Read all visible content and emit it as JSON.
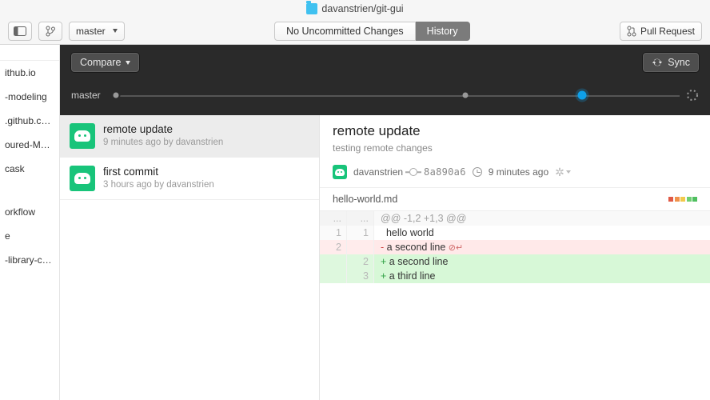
{
  "titlebar": {
    "repo_path": "davanstrien/git-gui"
  },
  "toolbar": {
    "branch_label": "master",
    "tab_changes": "No Uncommitted Changes",
    "tab_history": "History",
    "pull_request": "Pull Request",
    "active_tab": "history"
  },
  "compare_bar": {
    "compare_label": "Compare",
    "sync_label": "Sync",
    "branch_label": "master"
  },
  "repostrip": {
    "items": [
      "ithub.io",
      "-modeling",
      ".github.c…",
      "oured-M…",
      "cask",
      "",
      "orkflow",
      "e",
      "-library-c…"
    ]
  },
  "commits": [
    {
      "title": "remote update",
      "sub": "9 minutes ago by davanstrien",
      "selected": true
    },
    {
      "title": "first commit",
      "sub": "3 hours ago by davanstrien",
      "selected": false
    }
  ],
  "detail": {
    "title": "remote update",
    "summary": "testing remote changes",
    "author": "davanstrien",
    "sha": "8a890a6",
    "time": "9 minutes ago",
    "file": "hello-world.md",
    "hunk_header": "@@ -1,2 +1,3 @@",
    "lines": [
      {
        "old": "1",
        "new": "1",
        "type": "ctx",
        "text": "hello world"
      },
      {
        "old": "2",
        "new": "",
        "type": "del",
        "text": "a second line",
        "noeol": true
      },
      {
        "old": "",
        "new": "2",
        "type": "add",
        "text": "a second line"
      },
      {
        "old": "",
        "new": "3",
        "type": "add",
        "text": "a third line"
      }
    ]
  }
}
